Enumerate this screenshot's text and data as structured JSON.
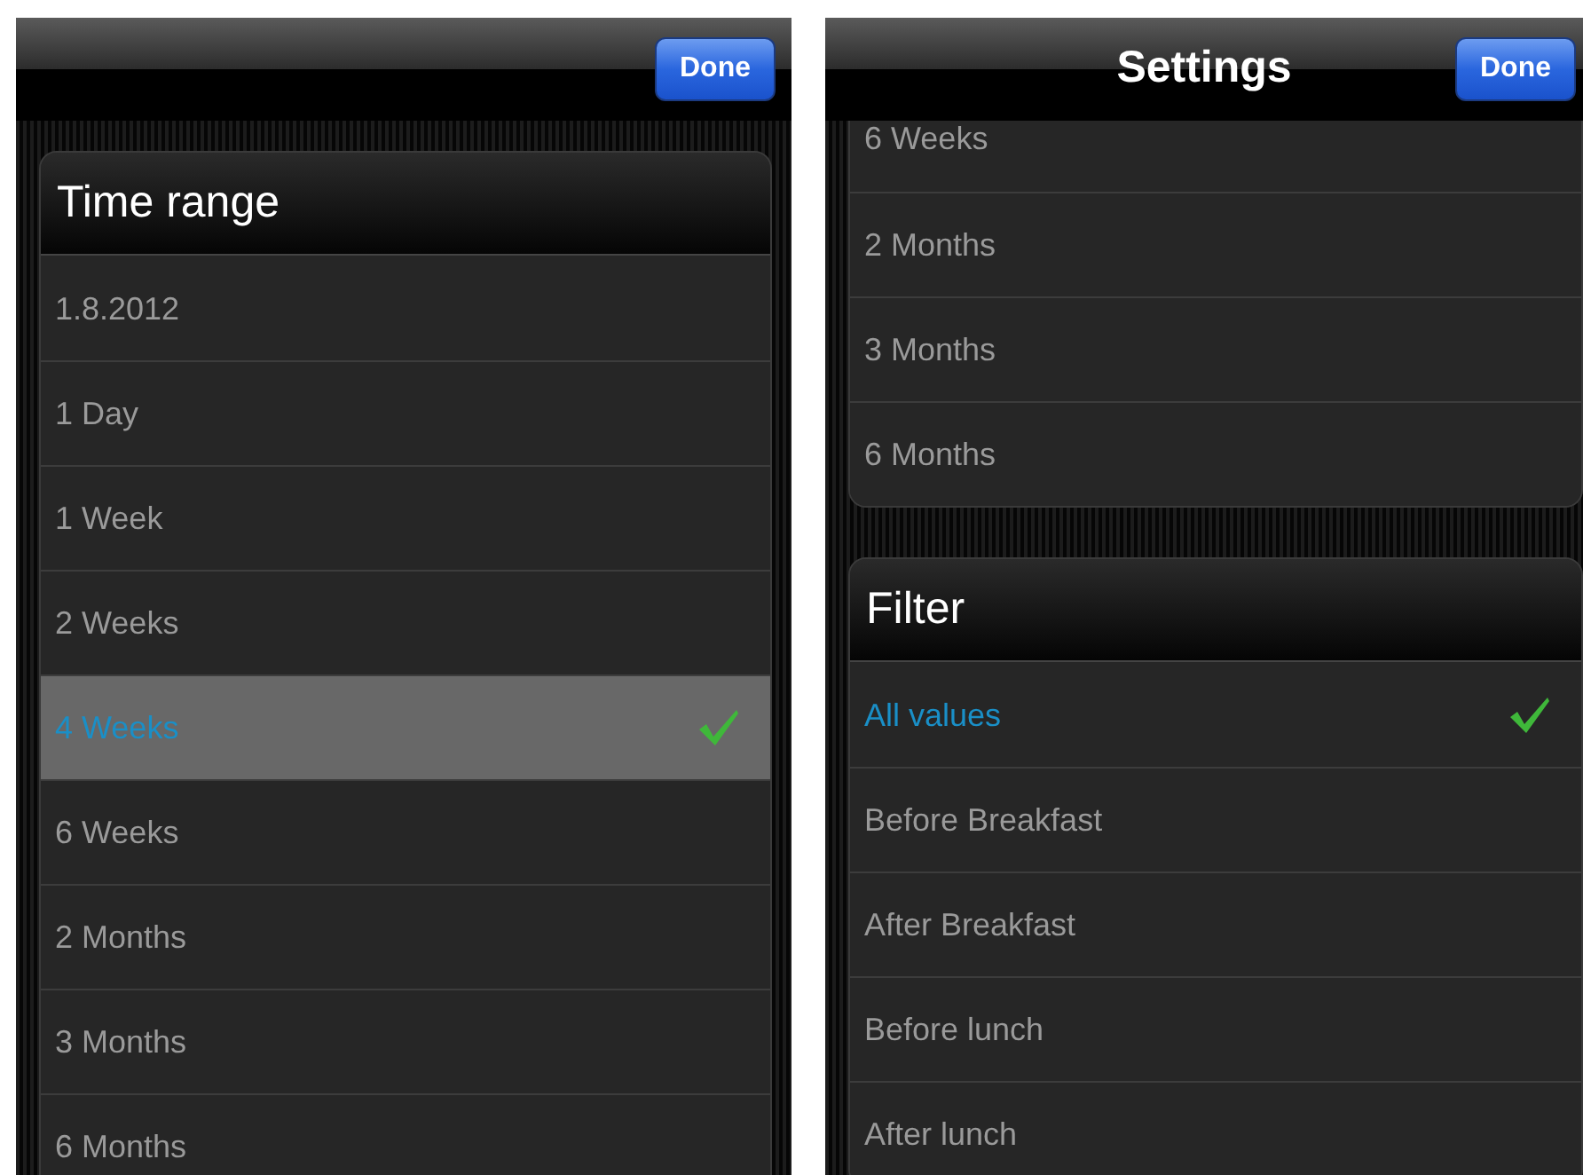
{
  "screens": [
    {
      "nav_bar": {
        "done_button": "Done"
      },
      "sections": [
        {
          "header": "Time range",
          "highlight_selected": true,
          "cut_top": false,
          "items": [
            {
              "label": "1.8.2012",
              "selected": false
            },
            {
              "label": "1 Day",
              "selected": false
            },
            {
              "label": "1 Week",
              "selected": false
            },
            {
              "label": "2 Weeks",
              "selected": false
            },
            {
              "label": "4 Weeks",
              "selected": true
            },
            {
              "label": "6 Weeks",
              "selected": false
            },
            {
              "label": "2 Months",
              "selected": false
            },
            {
              "label": "3 Months",
              "selected": false
            },
            {
              "label": "6 Months",
              "selected": false
            }
          ]
        }
      ]
    },
    {
      "nav_bar": {
        "title": "Settings",
        "done_button": "Done"
      },
      "sections": [
        {
          "cut_top": true,
          "items": [
            {
              "label": "6 Weeks",
              "selected": false
            },
            {
              "label": "2 Months",
              "selected": false
            },
            {
              "label": "3 Months",
              "selected": false
            },
            {
              "label": "6 Months",
              "selected": false
            }
          ]
        },
        {
          "header": "Filter",
          "highlight_selected": false,
          "cut_top": false,
          "items": [
            {
              "label": "All values",
              "selected": true
            },
            {
              "label": "Before Breakfast",
              "selected": false
            },
            {
              "label": "After Breakfast",
              "selected": false
            },
            {
              "label": "Before lunch",
              "selected": false
            },
            {
              "label": "After lunch",
              "selected": false
            }
          ]
        }
      ]
    }
  ]
}
